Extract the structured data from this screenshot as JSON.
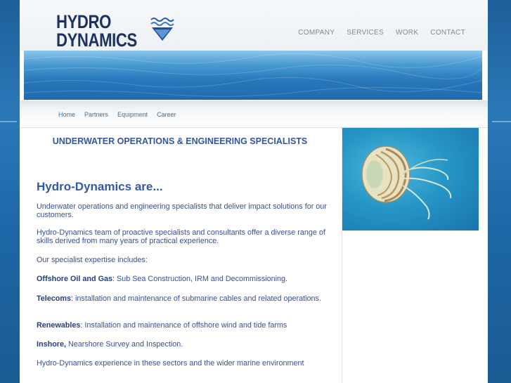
{
  "logo": {
    "line1": "HYDRO",
    "line2": "DYNAMICS"
  },
  "top_nav": [
    "COMPANY",
    "SERVICES",
    "WORK",
    "CONTACT"
  ],
  "sub_nav": [
    "Home",
    "Partners",
    "Equipment",
    "Career"
  ],
  "main": {
    "heading": "UNDERWATER OPERATIONS & ENGINEERING SPECIALISTS",
    "intro_heading": "Hydro-Dynamics are...",
    "p1": "Underwater operations and engineering specialists that deliver impact solutions for our customers.",
    "p2": "Hydro-Dynamics team of proactive specialists and consultants offer a diverse range of skills derived from many years of practical experience.",
    "p3": "Our specialist expertise includes:",
    "expertise": [
      {
        "term": "Offshore Oil and Gas",
        "text": ": Sub Sea Construction, IRM and Decommissioning."
      },
      {
        "term": "Telecoms",
        "text": ": installation and maintenance of submarine cables and related operations."
      },
      {
        "term": "Renewables",
        "text": ": Installation and maintenance of offshore wind and tide farms"
      },
      {
        "term": "Inshore,",
        "text": " Nearshore Survey and Inspection."
      }
    ],
    "p_last": "Hydro-Dynamics experience in these sectors and the wider marine environment"
  },
  "colors": {
    "navy": "#1b3262",
    "link_blue": "#34569c",
    "ocean": "#2878bb"
  },
  "icons": {
    "logo_mark": "waves-triangle-icon",
    "sidebar_image": "nautilus-photo"
  }
}
